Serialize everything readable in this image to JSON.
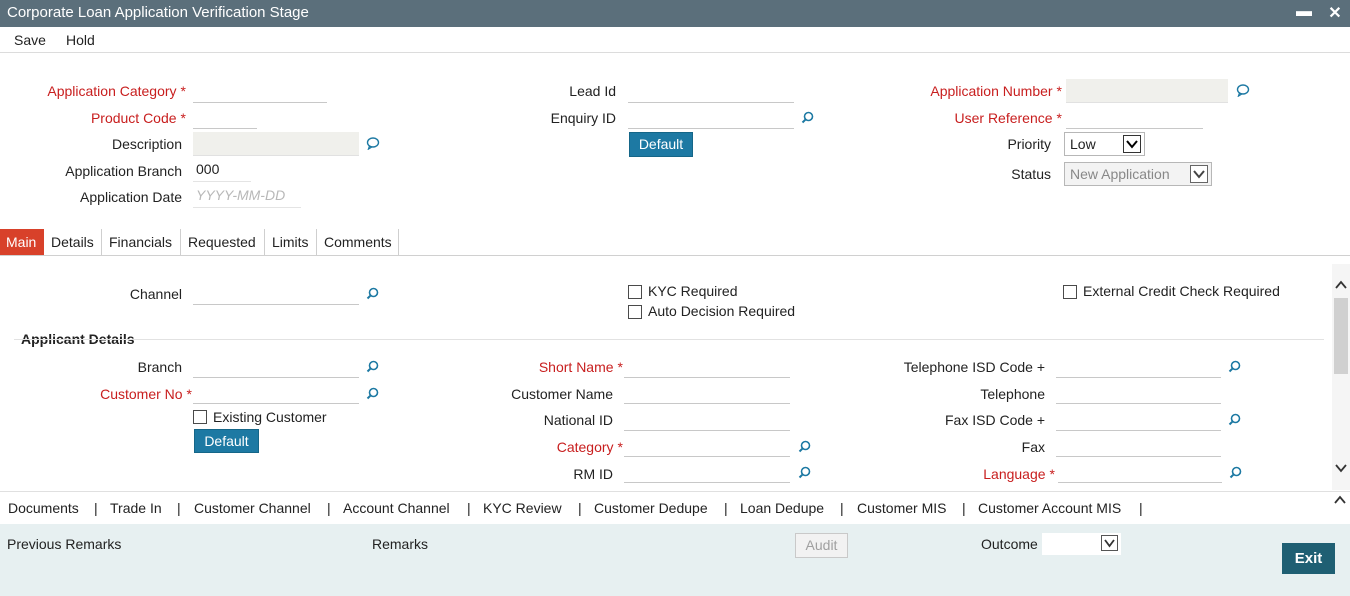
{
  "window": {
    "title": "Corporate Loan Application Verification Stage",
    "minimize": "▬",
    "close": "✕"
  },
  "menu": {
    "save": "Save",
    "hold": "Hold"
  },
  "header": {
    "application_category": "Application Category",
    "product_code": "Product Code",
    "description": "Description",
    "application_branch": "Application Branch",
    "application_branch_value": "000",
    "application_date": "Application Date",
    "application_date_placeholder": "YYYY-MM-DD",
    "lead_id": "Lead Id",
    "enquiry_id": "Enquiry ID",
    "default_button": "Default",
    "application_number": "Application Number",
    "user_reference": "User Reference",
    "priority": "Priority",
    "priority_value": "Low",
    "status": "Status",
    "status_value": "New Application",
    "required_mark": "*"
  },
  "tabs": [
    "Main",
    "Details",
    "Financials",
    "Requested",
    "Limits",
    "Comments"
  ],
  "main": {
    "channel": "Channel",
    "kyc_required": "KYC Required",
    "auto_decision_required": "Auto Decision Required",
    "external_credit_check": "External Credit Check Required",
    "applicant_details": "Applicant Details",
    "branch": "Branch",
    "customer_no": "Customer No",
    "existing_customer": "Existing Customer",
    "default_button": "Default",
    "short_name": "Short Name",
    "customer_name": "Customer Name",
    "national_id": "National ID",
    "category": "Category",
    "rm_id": "RM ID",
    "telephone_isd": "Telephone ISD Code +",
    "telephone": "Telephone",
    "fax_isd": "Fax ISD Code +",
    "fax": "Fax",
    "language": "Language"
  },
  "links": [
    "Documents",
    "Trade In",
    "Customer Channel",
    "Account Channel",
    "KYC Review",
    "Customer Dedupe",
    "Loan Dedupe",
    "Customer MIS",
    "Customer Account MIS"
  ],
  "link_separator": "|",
  "footer": {
    "previous_remarks": "Previous Remarks",
    "remarks": "Remarks",
    "audit": "Audit",
    "outcome": "Outcome",
    "exit": "Exit"
  },
  "colors": {
    "titlebar": "#5b6f7b",
    "accent_button": "#1d79a3",
    "active_tab": "#d8412a",
    "required": "#c81e1e",
    "footer_bg": "#e7f0f1",
    "exit_button": "#1f5f73"
  }
}
